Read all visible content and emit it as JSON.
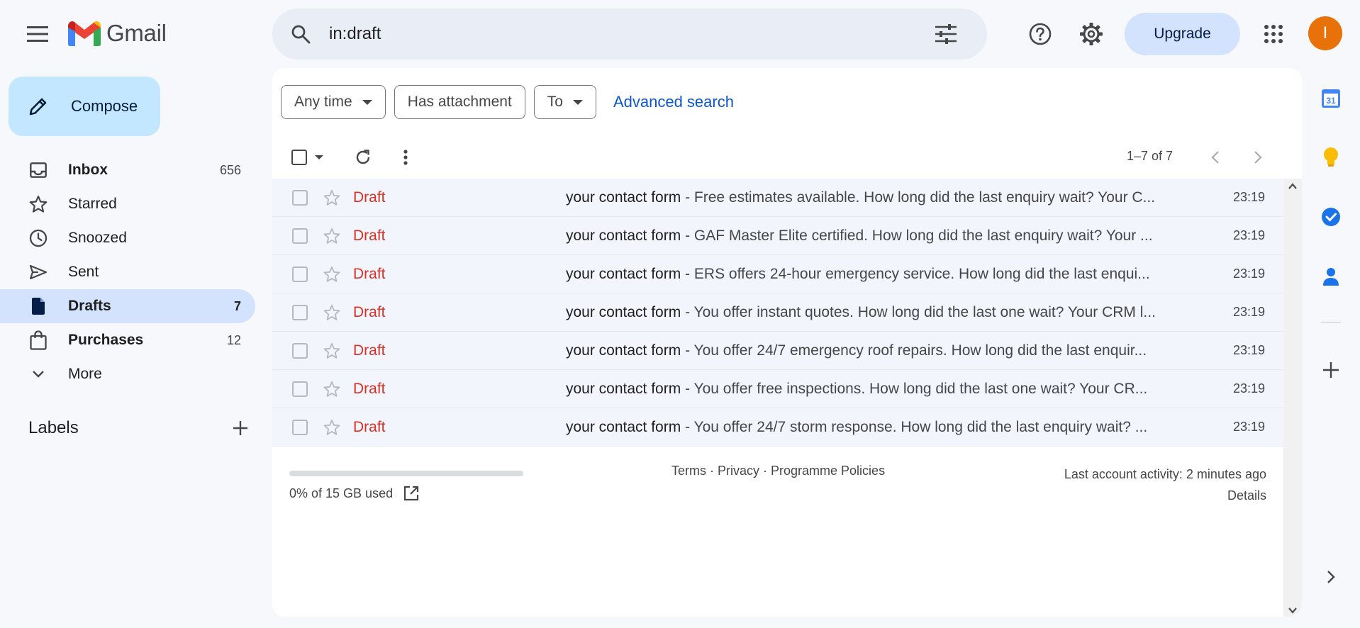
{
  "app": {
    "name": "Gmail",
    "logo_colors": {
      "red": "#ea4335",
      "blue": "#4285f4",
      "green": "#34a853",
      "yellow": "#fbbc04"
    }
  },
  "header": {
    "search_value": "in:draft",
    "upgrade_label": "Upgrade",
    "avatar_initial": "I",
    "avatar_color": "#e8710a"
  },
  "sidebar": {
    "compose_label": "Compose",
    "items": [
      {
        "label": "Inbox",
        "count": "656",
        "icon": "inbox-icon"
      },
      {
        "label": "Starred",
        "count": "",
        "icon": "star-icon"
      },
      {
        "label": "Snoozed",
        "count": "",
        "icon": "clock-icon"
      },
      {
        "label": "Sent",
        "count": "",
        "icon": "send-icon"
      },
      {
        "label": "Drafts",
        "count": "7",
        "icon": "draft-icon"
      },
      {
        "label": "Purchases",
        "count": "12",
        "icon": "shopping-bag-icon"
      },
      {
        "label": "More",
        "count": "",
        "icon": "chevron-down-icon"
      }
    ],
    "labels_heading": "Labels"
  },
  "filters": {
    "any_time": "Any time",
    "has_attachment": "Has attachment",
    "to": "To",
    "advanced_search": "Advanced search"
  },
  "toolbar": {
    "pager": "1–7 of 7"
  },
  "messages": [
    {
      "sender": "Draft",
      "subject": "your contact form",
      "snippet": " - Free estimates available. How long did the last enquiry wait? Your C...",
      "time": "23:19"
    },
    {
      "sender": "Draft",
      "subject": "your contact form",
      "snippet": " - GAF Master Elite certified. How long did the last enquiry wait? Your ...",
      "time": "23:19"
    },
    {
      "sender": "Draft",
      "subject": "your contact form",
      "snippet": " - ERS offers 24-hour emergency service. How long did the last enqui...",
      "time": "23:19"
    },
    {
      "sender": "Draft",
      "subject": "your contact form",
      "snippet": " - You offer instant quotes. How long did the last one wait? Your CRM l...",
      "time": "23:19"
    },
    {
      "sender": "Draft",
      "subject": "your contact form",
      "snippet": " - You offer 24/7 emergency roof repairs. How long did the last enquir...",
      "time": "23:19"
    },
    {
      "sender": "Draft",
      "subject": "your contact form",
      "snippet": " - You offer free inspections. How long did the last one wait? Your CR...",
      "time": "23:19"
    },
    {
      "sender": "Draft",
      "subject": "your contact form",
      "snippet": " - You offer 24/7 storm response. How long did the last enquiry wait? ...",
      "time": "23:19"
    }
  ],
  "footer": {
    "storage_text": "0% of 15 GB used",
    "storage_used_fraction": 0,
    "terms": "Terms",
    "privacy": "Privacy",
    "policies": "Programme Policies",
    "separator": " · ",
    "last_activity": "Last account activity: 2 minutes ago",
    "details": "Details"
  },
  "side_panel": {
    "calendar_day": "31",
    "apps": [
      "calendar-icon",
      "keep-icon",
      "tasks-icon",
      "contacts-icon",
      "add-icon",
      "chevron-right-icon"
    ]
  }
}
